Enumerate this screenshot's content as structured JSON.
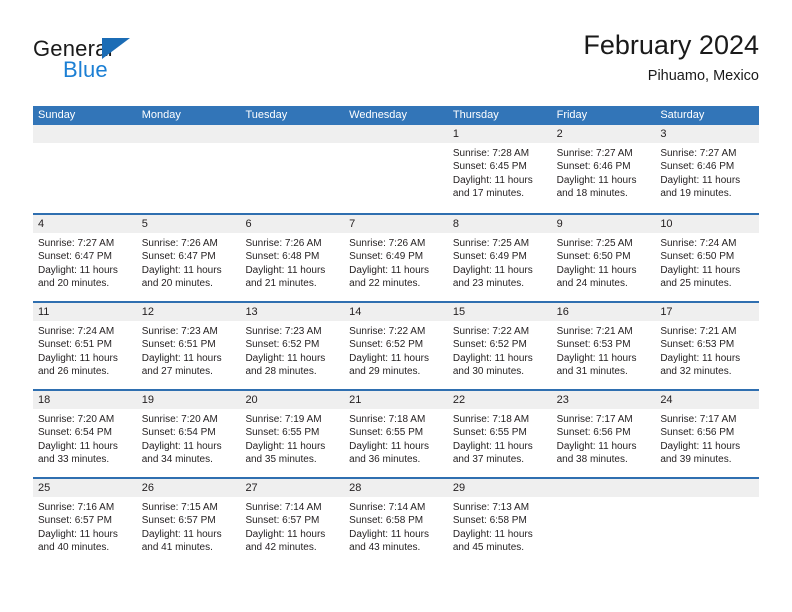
{
  "brand": {
    "name_part1": "General",
    "name_part2": "Blue"
  },
  "header": {
    "title": "February 2024",
    "subtitle": "Pihuamo, Mexico"
  },
  "colors": {
    "header_blue": "#3275b8",
    "row_divider_blue": "#2f6fb0",
    "day_band_gray": "#efefef",
    "brand_blue": "#1b7fd4",
    "text": "#231f20"
  },
  "weekdays": [
    "Sunday",
    "Monday",
    "Tuesday",
    "Wednesday",
    "Thursday",
    "Friday",
    "Saturday"
  ],
  "labels": {
    "sunrise_prefix": "Sunrise:",
    "sunset_prefix": "Sunset:",
    "daylight_prefix": "Daylight:"
  },
  "weeks": [
    [
      {
        "day": "",
        "sunrise": "",
        "sunset": "",
        "daylight_line1": "",
        "daylight_line2": ""
      },
      {
        "day": "",
        "sunrise": "",
        "sunset": "",
        "daylight_line1": "",
        "daylight_line2": ""
      },
      {
        "day": "",
        "sunrise": "",
        "sunset": "",
        "daylight_line1": "",
        "daylight_line2": ""
      },
      {
        "day": "",
        "sunrise": "",
        "sunset": "",
        "daylight_line1": "",
        "daylight_line2": ""
      },
      {
        "day": "1",
        "sunrise": "Sunrise: 7:28 AM",
        "sunset": "Sunset: 6:45 PM",
        "daylight_line1": "Daylight: 11 hours",
        "daylight_line2": "and 17 minutes."
      },
      {
        "day": "2",
        "sunrise": "Sunrise: 7:27 AM",
        "sunset": "Sunset: 6:46 PM",
        "daylight_line1": "Daylight: 11 hours",
        "daylight_line2": "and 18 minutes."
      },
      {
        "day": "3",
        "sunrise": "Sunrise: 7:27 AM",
        "sunset": "Sunset: 6:46 PM",
        "daylight_line1": "Daylight: 11 hours",
        "daylight_line2": "and 19 minutes."
      }
    ],
    [
      {
        "day": "4",
        "sunrise": "Sunrise: 7:27 AM",
        "sunset": "Sunset: 6:47 PM",
        "daylight_line1": "Daylight: 11 hours",
        "daylight_line2": "and 20 minutes."
      },
      {
        "day": "5",
        "sunrise": "Sunrise: 7:26 AM",
        "sunset": "Sunset: 6:47 PM",
        "daylight_line1": "Daylight: 11 hours",
        "daylight_line2": "and 20 minutes."
      },
      {
        "day": "6",
        "sunrise": "Sunrise: 7:26 AM",
        "sunset": "Sunset: 6:48 PM",
        "daylight_line1": "Daylight: 11 hours",
        "daylight_line2": "and 21 minutes."
      },
      {
        "day": "7",
        "sunrise": "Sunrise: 7:26 AM",
        "sunset": "Sunset: 6:49 PM",
        "daylight_line1": "Daylight: 11 hours",
        "daylight_line2": "and 22 minutes."
      },
      {
        "day": "8",
        "sunrise": "Sunrise: 7:25 AM",
        "sunset": "Sunset: 6:49 PM",
        "daylight_line1": "Daylight: 11 hours",
        "daylight_line2": "and 23 minutes."
      },
      {
        "day": "9",
        "sunrise": "Sunrise: 7:25 AM",
        "sunset": "Sunset: 6:50 PM",
        "daylight_line1": "Daylight: 11 hours",
        "daylight_line2": "and 24 minutes."
      },
      {
        "day": "10",
        "sunrise": "Sunrise: 7:24 AM",
        "sunset": "Sunset: 6:50 PM",
        "daylight_line1": "Daylight: 11 hours",
        "daylight_line2": "and 25 minutes."
      }
    ],
    [
      {
        "day": "11",
        "sunrise": "Sunrise: 7:24 AM",
        "sunset": "Sunset: 6:51 PM",
        "daylight_line1": "Daylight: 11 hours",
        "daylight_line2": "and 26 minutes."
      },
      {
        "day": "12",
        "sunrise": "Sunrise: 7:23 AM",
        "sunset": "Sunset: 6:51 PM",
        "daylight_line1": "Daylight: 11 hours",
        "daylight_line2": "and 27 minutes."
      },
      {
        "day": "13",
        "sunrise": "Sunrise: 7:23 AM",
        "sunset": "Sunset: 6:52 PM",
        "daylight_line1": "Daylight: 11 hours",
        "daylight_line2": "and 28 minutes."
      },
      {
        "day": "14",
        "sunrise": "Sunrise: 7:22 AM",
        "sunset": "Sunset: 6:52 PM",
        "daylight_line1": "Daylight: 11 hours",
        "daylight_line2": "and 29 minutes."
      },
      {
        "day": "15",
        "sunrise": "Sunrise: 7:22 AM",
        "sunset": "Sunset: 6:52 PM",
        "daylight_line1": "Daylight: 11 hours",
        "daylight_line2": "and 30 minutes."
      },
      {
        "day": "16",
        "sunrise": "Sunrise: 7:21 AM",
        "sunset": "Sunset: 6:53 PM",
        "daylight_line1": "Daylight: 11 hours",
        "daylight_line2": "and 31 minutes."
      },
      {
        "day": "17",
        "sunrise": "Sunrise: 7:21 AM",
        "sunset": "Sunset: 6:53 PM",
        "daylight_line1": "Daylight: 11 hours",
        "daylight_line2": "and 32 minutes."
      }
    ],
    [
      {
        "day": "18",
        "sunrise": "Sunrise: 7:20 AM",
        "sunset": "Sunset: 6:54 PM",
        "daylight_line1": "Daylight: 11 hours",
        "daylight_line2": "and 33 minutes."
      },
      {
        "day": "19",
        "sunrise": "Sunrise: 7:20 AM",
        "sunset": "Sunset: 6:54 PM",
        "daylight_line1": "Daylight: 11 hours",
        "daylight_line2": "and 34 minutes."
      },
      {
        "day": "20",
        "sunrise": "Sunrise: 7:19 AM",
        "sunset": "Sunset: 6:55 PM",
        "daylight_line1": "Daylight: 11 hours",
        "daylight_line2": "and 35 minutes."
      },
      {
        "day": "21",
        "sunrise": "Sunrise: 7:18 AM",
        "sunset": "Sunset: 6:55 PM",
        "daylight_line1": "Daylight: 11 hours",
        "daylight_line2": "and 36 minutes."
      },
      {
        "day": "22",
        "sunrise": "Sunrise: 7:18 AM",
        "sunset": "Sunset: 6:55 PM",
        "daylight_line1": "Daylight: 11 hours",
        "daylight_line2": "and 37 minutes."
      },
      {
        "day": "23",
        "sunrise": "Sunrise: 7:17 AM",
        "sunset": "Sunset: 6:56 PM",
        "daylight_line1": "Daylight: 11 hours",
        "daylight_line2": "and 38 minutes."
      },
      {
        "day": "24",
        "sunrise": "Sunrise: 7:17 AM",
        "sunset": "Sunset: 6:56 PM",
        "daylight_line1": "Daylight: 11 hours",
        "daylight_line2": "and 39 minutes."
      }
    ],
    [
      {
        "day": "25",
        "sunrise": "Sunrise: 7:16 AM",
        "sunset": "Sunset: 6:57 PM",
        "daylight_line1": "Daylight: 11 hours",
        "daylight_line2": "and 40 minutes."
      },
      {
        "day": "26",
        "sunrise": "Sunrise: 7:15 AM",
        "sunset": "Sunset: 6:57 PM",
        "daylight_line1": "Daylight: 11 hours",
        "daylight_line2": "and 41 minutes."
      },
      {
        "day": "27",
        "sunrise": "Sunrise: 7:14 AM",
        "sunset": "Sunset: 6:57 PM",
        "daylight_line1": "Daylight: 11 hours",
        "daylight_line2": "and 42 minutes."
      },
      {
        "day": "28",
        "sunrise": "Sunrise: 7:14 AM",
        "sunset": "Sunset: 6:58 PM",
        "daylight_line1": "Daylight: 11 hours",
        "daylight_line2": "and 43 minutes."
      },
      {
        "day": "29",
        "sunrise": "Sunrise: 7:13 AM",
        "sunset": "Sunset: 6:58 PM",
        "daylight_line1": "Daylight: 11 hours",
        "daylight_line2": "and 45 minutes."
      },
      {
        "day": "",
        "sunrise": "",
        "sunset": "",
        "daylight_line1": "",
        "daylight_line2": ""
      },
      {
        "day": "",
        "sunrise": "",
        "sunset": "",
        "daylight_line1": "",
        "daylight_line2": ""
      }
    ]
  ]
}
